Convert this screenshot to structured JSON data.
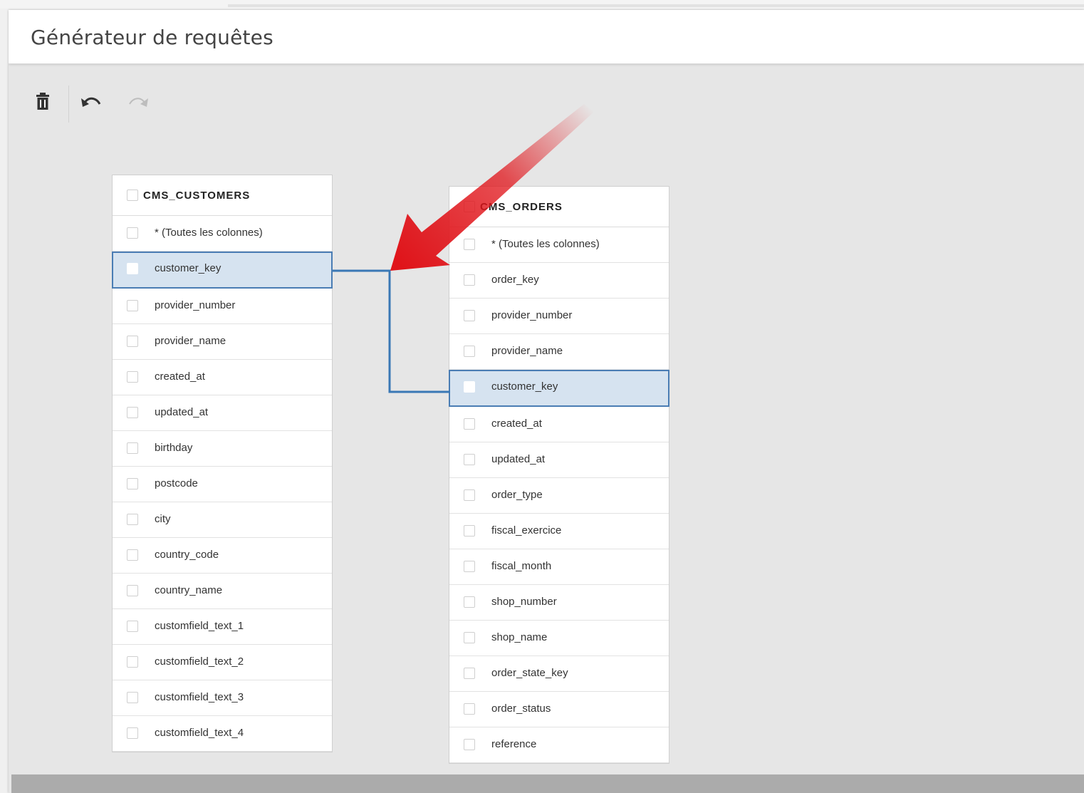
{
  "header": {
    "title": "Générateur de requêtes"
  },
  "toolbar": {
    "delete_icon": "trash-icon",
    "undo_icon": "undo-icon",
    "redo_icon": "redo-icon"
  },
  "tables": [
    {
      "name": "CMS_CUSTOMERS",
      "columns": [
        "* (Toutes les colonnes)",
        "customer_key",
        "provider_number",
        "provider_name",
        "created_at",
        "updated_at",
        "birthday",
        "postcode",
        "city",
        "country_code",
        "country_name",
        "customfield_text_1",
        "customfield_text_2",
        "customfield_text_3",
        "customfield_text_4"
      ],
      "selected_column": "customer_key"
    },
    {
      "name": "CMS_ORDERS",
      "columns": [
        "* (Toutes les colonnes)",
        "order_key",
        "provider_number",
        "provider_name",
        "customer_key",
        "created_at",
        "updated_at",
        "order_type",
        "fiscal_exercice",
        "fiscal_month",
        "shop_number",
        "shop_name",
        "order_state_key",
        "order_status",
        "reference"
      ],
      "selected_column": "customer_key"
    }
  ],
  "colors": {
    "join_line": "#3a78b5",
    "selected_row_bg": "#d6e3f0",
    "annotation_arrow": "#e0141a"
  }
}
